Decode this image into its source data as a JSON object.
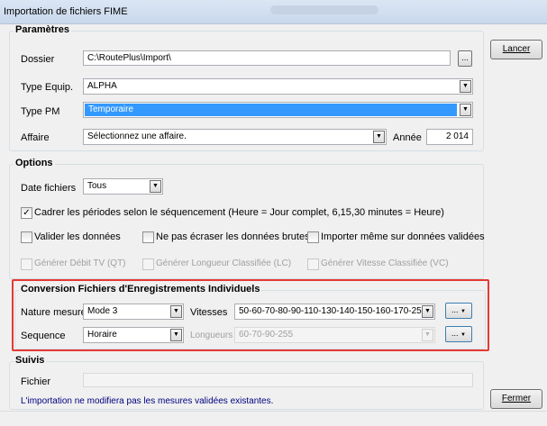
{
  "window": {
    "title": "Importation de fichiers FIME"
  },
  "parametres": {
    "title": "Paramètres",
    "dossier": {
      "label": "Dossier",
      "value": "C:\\RoutePlus\\Import\\",
      "browse": "..."
    },
    "type_equip": {
      "label": "Type Equip.",
      "value": "ALPHA"
    },
    "type_pm": {
      "label": "Type PM",
      "value": "Temporaire"
    },
    "affaire": {
      "label": "Affaire",
      "value": "Sélectionnez une affaire.",
      "annee_label": "Année",
      "annee_value": "2 014"
    }
  },
  "options": {
    "title": "Options",
    "date_fichiers": {
      "label": "Date fichiers",
      "value": "Tous"
    },
    "cadrer": {
      "label": "Cadrer les périodes selon le séquencement (Heure = Jour complet, 6,15,30 minutes = Heure)",
      "checked": true
    },
    "valider": {
      "label": "Valider les données",
      "checked": false
    },
    "ne_pas_ecraser": {
      "label": "Ne pas écraser les données brutes",
      "checked": false
    },
    "importer_meme": {
      "label": "Importer même sur données validées",
      "checked": false
    },
    "generer_debit": {
      "label": "Générer Débit TV (QT)",
      "checked": false
    },
    "generer_longueur": {
      "label": "Générer Longueur Classifiée (LC)",
      "checked": false
    },
    "generer_vitesse": {
      "label": "Générer Vitesse Classifiée (VC)",
      "checked": false
    }
  },
  "conversion": {
    "title": "Conversion Fichiers d'Enregistrements Individuels",
    "nature": {
      "label": "Nature mesure",
      "value": "Mode 3"
    },
    "vitesses": {
      "label": "Vitesses",
      "value": "50-60-70-80-90-110-130-140-150-160-170-25",
      "btn": "..."
    },
    "sequence": {
      "label": "Sequence",
      "value": "Horaire"
    },
    "longueurs": {
      "label": "Longueurs",
      "value": "60-70-90-255",
      "btn": "..."
    }
  },
  "suivis": {
    "title": "Suivis",
    "fichier_label": "Fichier",
    "fichier_value": "",
    "note": "L'importation ne modifiera pas les mesures validées existantes."
  },
  "buttons": {
    "lancer": "Lancer",
    "fermer": "Fermer"
  },
  "icons": {
    "dropdown": "▼",
    "checkmark": "✓"
  }
}
